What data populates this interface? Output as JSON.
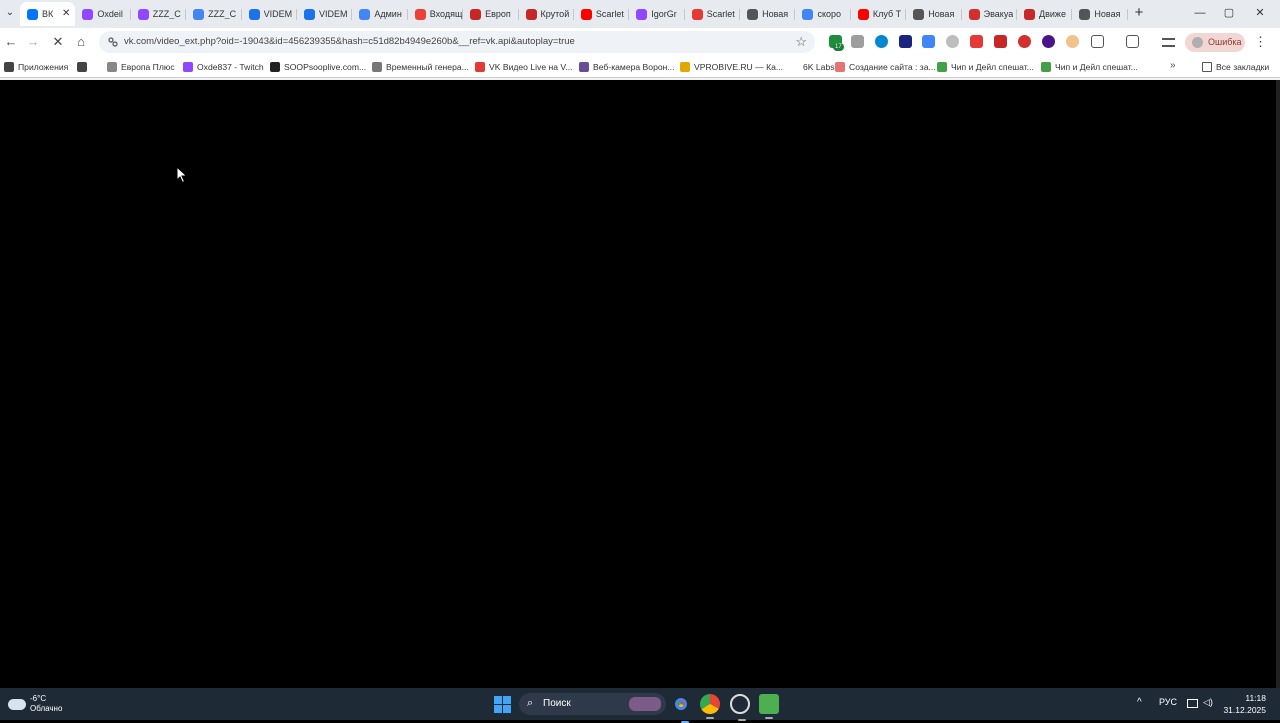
{
  "browser": {
    "tabs": [
      {
        "title": "ВК",
        "favicon": "vk-icon",
        "color": "#0077ff",
        "active": true
      },
      {
        "title": "Oxdeil",
        "favicon": "twitch-icon",
        "color": "#9146ff"
      },
      {
        "title": "ZZZ_C",
        "favicon": "twitch-icon",
        "color": "#9146ff"
      },
      {
        "title": "ZZZ_C",
        "favicon": "google-icon",
        "color": "#4285f4"
      },
      {
        "title": "VIDEM",
        "favicon": "globe-icon",
        "color": "#1a73e8"
      },
      {
        "title": "VIDEM",
        "favicon": "globe-icon",
        "color": "#1a73e8"
      },
      {
        "title": "Админ",
        "favicon": "google-icon",
        "color": "#4285f4"
      },
      {
        "title": "Входящ",
        "favicon": "gmail-icon",
        "color": "#ea4335"
      },
      {
        "title": "Европ",
        "favicon": "radio-icon",
        "color": "#c62828"
      },
      {
        "title": "Крутой",
        "favicon": "radio-icon",
        "color": "#c62828"
      },
      {
        "title": "Scarlet",
        "favicon": "youtube-icon",
        "color": "#ff0000"
      },
      {
        "title": "IgorGr",
        "favicon": "twitch-icon",
        "color": "#9146ff"
      },
      {
        "title": "Scarlet",
        "favicon": "vk-video-icon",
        "color": "#e53935"
      },
      {
        "title": "Новая",
        "favicon": "globe-icon",
        "color": "#555555"
      },
      {
        "title": "скоро",
        "favicon": "google-icon",
        "color": "#4285f4"
      },
      {
        "title": "Клуб Т",
        "favicon": "youtube-icon",
        "color": "#ff0000"
      },
      {
        "title": "Новая",
        "favicon": "globe-icon",
        "color": "#555555"
      },
      {
        "title": "Эвакуа",
        "favicon": "pdf-icon",
        "color": "#d32f2f"
      },
      {
        "title": "Движе",
        "favicon": "news-icon",
        "color": "#c62828"
      },
      {
        "title": "Новая",
        "favicon": "globe-icon",
        "color": "#555555"
      }
    ],
    "new_tab": "+",
    "tab_list": "⌄",
    "window_controls": {
      "minimize": "—",
      "maximize": "▢",
      "close": "✕"
    },
    "nav": {
      "back": "←",
      "forward": "→",
      "stop": "✕",
      "home": "⌂"
    },
    "url": "vk.com/video_ext.php?oid=-19043&id=456239355&hash=c51d82b4949e260b&__ref=vk.api&autoplay=true",
    "bookmark_star": "☆",
    "extension_badge": "17",
    "profile_status": "Ошибка",
    "menu": "⋮",
    "bookmarks": [
      {
        "label": "Приложения",
        "icon": "apps-icon",
        "color": "#444444"
      },
      {
        "label": "",
        "icon": "grid-icon",
        "color": "#444444"
      },
      {
        "label": "Европа Плюс",
        "icon": "radio-icon",
        "color": "#888888"
      },
      {
        "label": "Oxde837 - Twitch",
        "icon": "twitch-icon",
        "color": "#9146ff"
      },
      {
        "label": "SOOPsooplive.com...",
        "icon": "soop-icon",
        "color": "#222222"
      },
      {
        "label": "Временный генера...",
        "icon": "mail-icon",
        "color": "#777777"
      },
      {
        "label": "VK Видео Live на V...",
        "icon": "vk-video-icon",
        "color": "#e53935"
      },
      {
        "label": "Веб-камера Ворон...",
        "icon": "camera-icon",
        "color": "#6a4c93"
      },
      {
        "label": "VPROBIVE.RU — Ка...",
        "icon": "key-icon",
        "color": "#e0a800"
      },
      {
        "label": "6K Labs",
        "icon": "labs-icon",
        "color": "#ffffff"
      },
      {
        "label": "Создание сайта : за...",
        "icon": "site-icon",
        "color": "#e57373"
      },
      {
        "label": "Чип и Дейл спешат...",
        "icon": "hd-icon",
        "color": "#43a047"
      },
      {
        "label": "Чип и Дейл спешат...",
        "icon": "check-icon",
        "color": "#43a047"
      }
    ],
    "bookmarks_more": "»",
    "all_bookmarks": "Все закладки"
  },
  "taskbar": {
    "weather_temp": "-6°C",
    "weather_desc": "Облачно",
    "search_label": "Поиск",
    "language": "РУС",
    "time": "11:18",
    "date": "31.12.2025"
  }
}
